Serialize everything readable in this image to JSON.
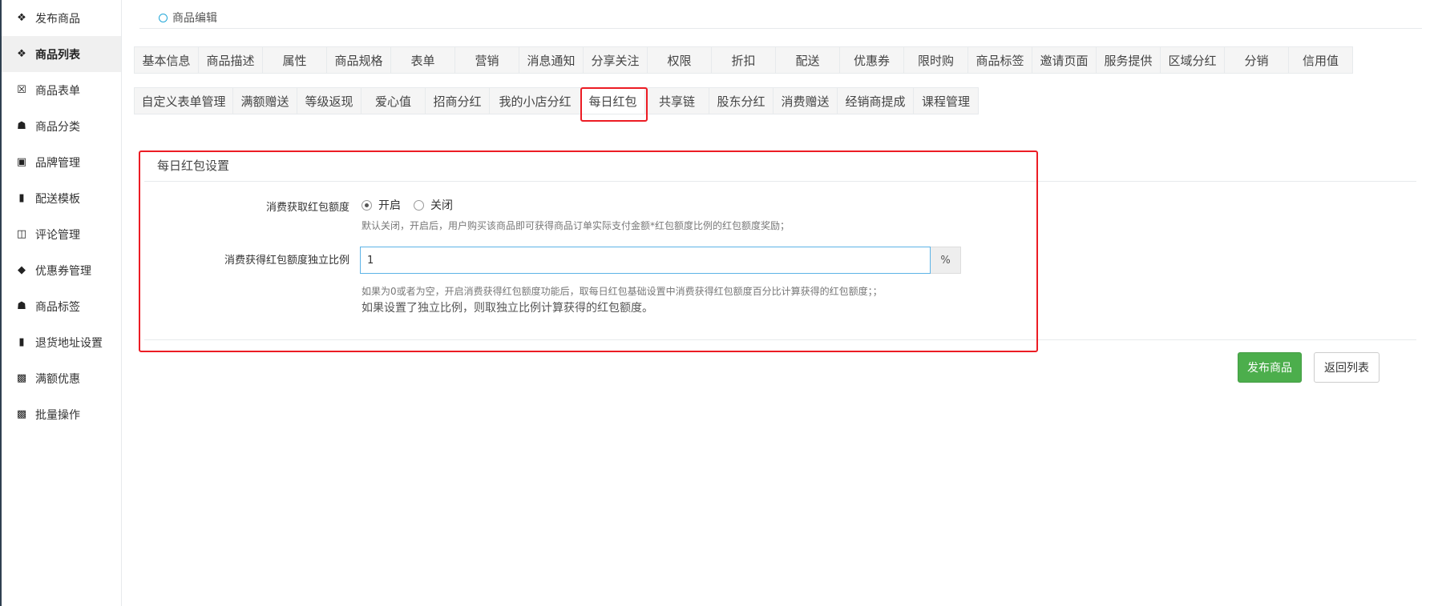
{
  "sidebar": {
    "items": [
      {
        "label": "发布商品",
        "icon": "cubes-icon"
      },
      {
        "label": "商品列表",
        "icon": "cubes-icon",
        "active": true
      },
      {
        "label": "商品表单",
        "icon": "excel-file-icon"
      },
      {
        "label": "商品分类",
        "icon": "sitemap-icon"
      },
      {
        "label": "品牌管理",
        "icon": "briefcase-icon"
      },
      {
        "label": "配送模板",
        "icon": "truck-icon"
      },
      {
        "label": "评论管理",
        "icon": "columns-icon"
      },
      {
        "label": "优惠券管理",
        "icon": "tags-icon"
      },
      {
        "label": "商品标签",
        "icon": "sitemap-icon"
      },
      {
        "label": "退货地址设置",
        "icon": "truck-icon"
      },
      {
        "label": "满额优惠",
        "icon": "gift-icon"
      },
      {
        "label": "批量操作",
        "icon": "gift-icon"
      }
    ]
  },
  "breadcrumb": {
    "label": "商品编辑"
  },
  "tabs": {
    "row1": [
      "基本信息",
      "商品描述",
      "属性",
      "商品规格",
      "表单",
      "营销",
      "消息通知",
      "分享关注",
      "权限",
      "折扣",
      "配送",
      "优惠券",
      "限时购",
      "商品标签",
      "邀请页面",
      "服务提供",
      "区域分红",
      "分销",
      "信用值"
    ],
    "row2": [
      "自定义表单管理",
      "满额赠送",
      "等级返现",
      "爱心值",
      "招商分红",
      "我的小店分红",
      "每日红包",
      "共享链",
      "股东分红",
      "消费赠送",
      "经销商提成",
      "课程管理"
    ],
    "active": "每日红包"
  },
  "panel": {
    "title": "每日红包设置",
    "field1": {
      "label": "消费获取红包额度",
      "options": [
        "开启",
        "关闭"
      ],
      "selected": "开启",
      "hint": "默认关闭，开启后，用户购买该商品即可获得商品订单实际支付金额*红包额度比例的红包额度奖励；"
    },
    "field2": {
      "label": "消费获得红包额度独立比例",
      "value": "1",
      "addon": "%",
      "hint1": "如果为0或者为空，开启消费获得红包额度功能后，取每日红包基础设置中消费获得红包额度百分比计算获得的红包额度；；",
      "hint2": "如果设置了独立比例，则取独立比例计算获得的红包额度。"
    }
  },
  "buttons": {
    "publish": "发布商品",
    "back": "返回列表"
  },
  "colors": {
    "highlight": "#ec1c24",
    "primary": "#4cae4c",
    "input_focus": "#5cb3e6"
  }
}
